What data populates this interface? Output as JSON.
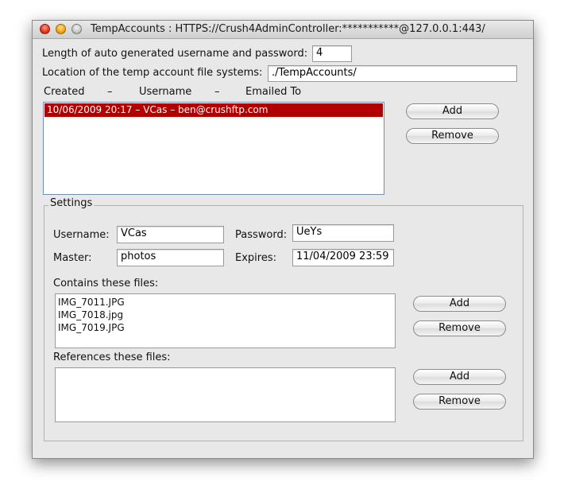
{
  "window": {
    "title": "TempAccounts : HTTPS://Crush4AdminController:***********@127.0.0.1:443/"
  },
  "top": {
    "length_label": "Length of auto generated username and password:",
    "length_value": "4",
    "location_label": "Location of the temp account file systems:",
    "location_value": "./TempAccounts/"
  },
  "accounts": {
    "header_created": "Created",
    "header_sep1": "–",
    "header_username": "Username",
    "header_sep2": "–",
    "header_emailed": "Emailed To",
    "items": [
      "10/06/2009 20:17 – VCas – ben@crushftp.com"
    ],
    "add_label": "Add",
    "remove_label": "Remove"
  },
  "settings": {
    "legend": "Settings",
    "username_label": "Username:",
    "username_value": "VCas",
    "password_label": "Password:",
    "password_value": "UeYs",
    "master_label": "Master:",
    "master_value": "photos",
    "expires_label": "Expires:",
    "expires_value": "11/04/2009 23:59",
    "contains_label": "Contains these files:",
    "contains_files": [
      "IMG_7011.JPG",
      "IMG_7018.jpg",
      "IMG_7019.JPG"
    ],
    "contains_add": "Add",
    "contains_remove": "Remove",
    "references_label": "References these files:",
    "references_add": "Add",
    "references_remove": "Remove"
  },
  "colors": {
    "selection": "#b00000",
    "window_bg": "#e8e8e8"
  }
}
